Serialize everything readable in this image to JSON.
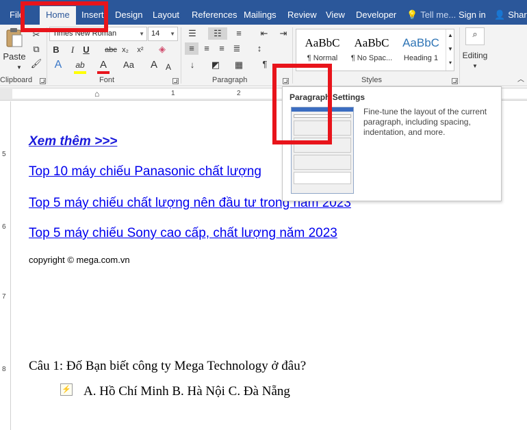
{
  "tabs": [
    "File",
    "Home",
    "Insert",
    "Design",
    "Layout",
    "References",
    "Mailings",
    "Review",
    "View",
    "Developer",
    "Tell me...",
    "Sign in",
    "Share"
  ],
  "ribbon": {
    "clipboard": {
      "paste": "Paste",
      "label": "Clipboard"
    },
    "font": {
      "name": "Times New Roman",
      "size": "14",
      "bold": "B",
      "italic": "I",
      "underline": "U",
      "strike": "abc",
      "subscript": "x₂",
      "superscript": "x²",
      "text_effects": "A",
      "highlight": "ab",
      "font_color": "A",
      "change_case": "Aa",
      "grow": "A",
      "shrink": "A",
      "label": "Font"
    },
    "paragraph": {
      "label": "Paragraph",
      "pilcrow": "¶"
    },
    "styles": {
      "items": [
        {
          "sample": "AaBbC",
          "name": "¶ Normal"
        },
        {
          "sample": "AaBbC",
          "name": "¶ No Spac..."
        },
        {
          "sample": "AaBbC",
          "name": "Heading 1"
        }
      ],
      "label": "Styles"
    },
    "editing": {
      "label": "Editing"
    }
  },
  "tooltip": {
    "title": "Paragraph Settings",
    "description": "Fine-tune the layout of the current paragraph, including spacing, indentation, and more."
  },
  "ruler": {
    "h": [
      "1",
      "2"
    ],
    "v": [
      "5",
      "6",
      "7",
      "8"
    ]
  },
  "document": {
    "see_more": "Xem thêm >>>",
    "links": [
      "Top 10 máy chiếu Panasonic chất lượng",
      "Top 5 máy chiếu chất lượng nên đầu tư trong năm 2023",
      "Top 5 máy chiếu Sony cao cấp, chất lượng năm 2023"
    ],
    "copyright": "copyright © mega.com.vn",
    "question": "Câu 1: Đố Bạn biết công ty Mega Technology ở đâu?",
    "answers": "A. Hồ Chí Minh  B. Hà Nội  C. Đà Nẵng"
  },
  "colors": {
    "ribbon_blue": "#2b579a",
    "highlight_red": "#e8141b",
    "link_blue": "#0000ee",
    "see_more_blue": "#1a1adb"
  }
}
